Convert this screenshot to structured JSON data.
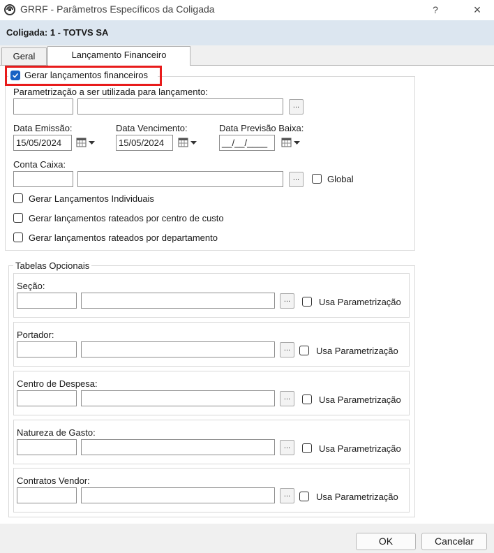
{
  "window": {
    "title": "GRRF - Parâmetros Específicos da Coligada",
    "help_label": "?",
    "close_label": "×"
  },
  "banner": {
    "text": "Coligada: 1 - TOTVS SA"
  },
  "tabs": [
    {
      "label": "Geral",
      "active": false
    },
    {
      "label": "Lançamento Financeiro",
      "active": true
    }
  ],
  "main_group": {
    "checkbox_label": "Gerar lançamentos financeiros",
    "checked": true,
    "parametrizacao_label": "Parametrização a ser utilizada para lançamento:",
    "parametrizacao_code": "",
    "parametrizacao_desc": "",
    "dots_label": "...",
    "data_emissao_label": "Data Emissão:",
    "data_emissao_value": "15/05/2024",
    "data_vencimento_label": "Data Vencimento:",
    "data_vencimento_value": "15/05/2024",
    "data_previsao_label": "Data Previsão Baixa:",
    "data_previsao_value": "__/__/____",
    "conta_caixa_label": "Conta Caixa:",
    "conta_caixa_code": "",
    "conta_caixa_desc": "",
    "global_label": "Global",
    "options": [
      {
        "label": "Gerar Lançamentos Individuais",
        "checked": false
      },
      {
        "label": "Gerar lançamentos rateados por centro de custo",
        "checked": false
      },
      {
        "label": "Gerar lançamentos rateados por departamento",
        "checked": false
      }
    ]
  },
  "tabelas": {
    "title": "Tabelas Opcionais",
    "usa_label": "Usa Parametrização",
    "dots_label": "...",
    "sections": [
      {
        "label": "Seção:"
      },
      {
        "label": "Portador:"
      },
      {
        "label": "Centro de Despesa:"
      },
      {
        "label": "Natureza de Gasto:"
      },
      {
        "label": "Contratos Vendor:"
      }
    ]
  },
  "footer": {
    "ok_label": "OK",
    "cancel_label": "Cancelar"
  },
  "colors": {
    "highlight": "#e81b1b",
    "checkbox_accent": "#1862c4",
    "banner_bg": "#dce6f0"
  }
}
